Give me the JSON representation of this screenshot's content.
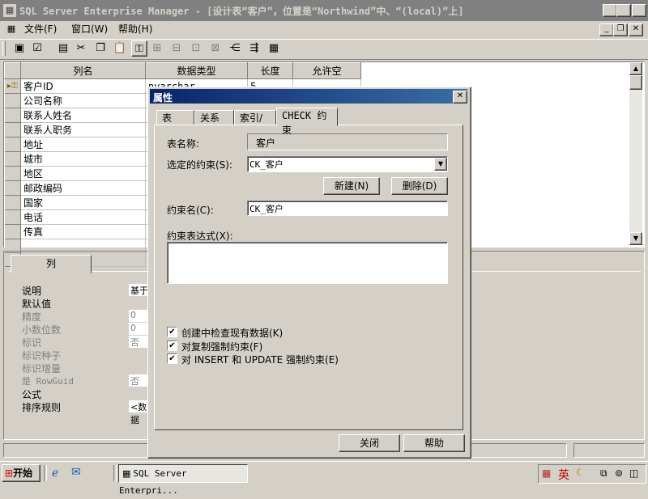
{
  "window": {
    "title": "SQL Server Enterprise Manager - [设计表“客户”，位置是“Northwind”中、“(local)”上]"
  },
  "menu": {
    "items": [
      "文件(F)",
      "窗口(W)",
      "帮助(H)"
    ]
  },
  "toolbar": {
    "icons": [
      "save-icon",
      "properties-icon",
      "table-icon",
      "cut-icon",
      "copy-icon",
      "paste-icon",
      "primary-key-icon",
      "relationships-icon",
      "indexes-icon",
      "constraints-icon",
      "manage-icon",
      "triggers-icon",
      "dependencies-icon",
      "grid-icon"
    ]
  },
  "grid": {
    "headers": [
      "列名",
      "数据类型",
      "长度",
      "允许空"
    ],
    "rows": [
      {
        "name": "客户ID",
        "type": "nvarchar",
        "length": "5",
        "key": true
      },
      {
        "name": "公司名称",
        "type": "",
        "length": "",
        "key": false
      },
      {
        "name": "联系人姓名",
        "type": "",
        "length": "",
        "key": false
      },
      {
        "name": "联系人职务",
        "type": "",
        "length": "",
        "key": false
      },
      {
        "name": "地址",
        "type": "",
        "length": "",
        "key": false
      },
      {
        "name": "城市",
        "type": "",
        "length": "",
        "key": false
      },
      {
        "name": "地区",
        "type": "",
        "length": "",
        "key": false
      },
      {
        "name": "邮政编码",
        "type": "",
        "length": "",
        "key": false
      },
      {
        "name": "国家",
        "type": "",
        "length": "",
        "key": false
      },
      {
        "name": "电话",
        "type": "",
        "length": "",
        "key": false
      },
      {
        "name": "传真",
        "type": "",
        "length": "",
        "key": false
      }
    ]
  },
  "column_props": {
    "tab": "列",
    "labels": {
      "description": "说明",
      "default": "默认值",
      "precision": "精度",
      "scale": "小数位数",
      "identity": "标识",
      "identity_seed": "标识种子",
      "identity_incr": "标识增量",
      "rowguid": "是 RowGuid",
      "formula": "公式",
      "collation": "排序规则"
    },
    "values": {
      "description": "基于",
      "precision": "0",
      "scale": "0",
      "identity": "否",
      "rowguid": "否",
      "collation": "<数据"
    }
  },
  "dialog": {
    "title": "属性",
    "tabs": [
      "表",
      "关系",
      "索引/键",
      "CHECK 约束"
    ],
    "active_tab": "CHECK 约束",
    "table_name_label": "表名称:",
    "table_name_value": "客户",
    "selected_constraint_label": "选定的约束(S):",
    "selected_constraint_value": "CK_客户",
    "new_button": "新建(N)",
    "delete_button": "删除(D)",
    "constraint_name_label": "约束名(C):",
    "constraint_name_value": "CK_客户",
    "expression_label": "约束表达式(X):",
    "expression_value": "",
    "checkboxes": [
      {
        "label": "创建中检查现有数据(K)",
        "checked": true
      },
      {
        "label": "对复制强制约束(F)",
        "checked": true
      },
      {
        "label": "对 INSERT 和 UPDATE 强制约束(E)",
        "checked": true
      }
    ],
    "close_button": "关闭",
    "help_button": "帮助"
  },
  "taskbar": {
    "start_label": "开始",
    "task_label": "SQL Server Enterpri...",
    "ime_label": "英"
  }
}
